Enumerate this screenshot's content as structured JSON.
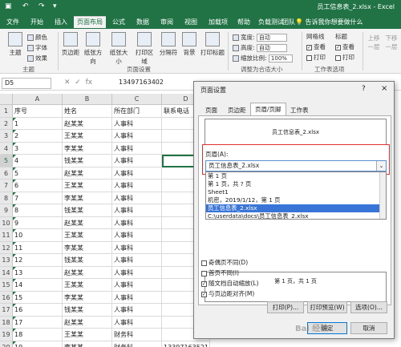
{
  "titlebar": {
    "doc_title": "员工信息表_2.xlsx - Excel"
  },
  "tabs": [
    "文件",
    "开始",
    "插入",
    "页面布局",
    "公式",
    "数据",
    "审阅",
    "视图",
    "加载项",
    "帮助",
    "负载测试",
    "团队"
  ],
  "active_tab": "页面布局",
  "tell_me": "告诉我你想要做什么",
  "ribbon": {
    "theme": "主题",
    "colors": "颜色",
    "fonts": "字体",
    "effects": "效果",
    "theme_group": "主题",
    "margins": "页边距",
    "orientation": "纸张方向",
    "size": "纸张大小",
    "print_area": "打印区域",
    "breaks": "分隔符",
    "background": "背景",
    "print_titles": "打印标题",
    "page_setup_group": "页面设置",
    "width_label": "宽度:",
    "height_label": "高度:",
    "scale_label": "缩放比例:",
    "auto": "自动",
    "scale_value": "100%",
    "fit_group": "调整为合适大小",
    "gridlines": "网格线",
    "headings": "标题",
    "view": "查看",
    "print": "打印",
    "sheet_options_group": "工作表选项",
    "bring_forward": "上移一层",
    "send_backward": "下移一层"
  },
  "formula_bar": {
    "name_box": "D5",
    "value": "13497163402"
  },
  "columns": [
    "A",
    "B",
    "C",
    "D"
  ],
  "row_numbers": [
    "1",
    "2",
    "3",
    "4",
    "5",
    "6",
    "7",
    "8",
    "9",
    "10",
    "11",
    "12",
    "13",
    "14",
    "15",
    "16",
    "17",
    "18",
    "19",
    "20"
  ],
  "rows": [
    [
      "序号",
      "姓名",
      "所在部门",
      "联系电话"
    ],
    [
      "1",
      "赵某某",
      "人事科",
      ""
    ],
    [
      "2",
      "王某某",
      "人事科",
      ""
    ],
    [
      "3",
      "李某某",
      "人事科",
      ""
    ],
    [
      "4",
      "钱某某",
      "人事科",
      ""
    ],
    [
      "5",
      "赵某某",
      "人事科",
      ""
    ],
    [
      "6",
      "王某某",
      "人事科",
      ""
    ],
    [
      "7",
      "李某某",
      "人事科",
      ""
    ],
    [
      "8",
      "钱某某",
      "人事科",
      ""
    ],
    [
      "9",
      "赵某某",
      "人事科",
      ""
    ],
    [
      "10",
      "王某某",
      "人事科",
      ""
    ],
    [
      "11",
      "李某某",
      "人事科",
      ""
    ],
    [
      "12",
      "钱某某",
      "人事科",
      ""
    ],
    [
      "13",
      "赵某某",
      "人事科",
      ""
    ],
    [
      "14",
      "王某某",
      "人事科",
      ""
    ],
    [
      "15",
      "李某某",
      "人事科",
      ""
    ],
    [
      "16",
      "钱某某",
      "人事科",
      ""
    ],
    [
      "17",
      "赵某某",
      "人事科",
      ""
    ],
    [
      "18",
      "王某某",
      "财务科",
      ""
    ],
    [
      "19",
      "李某某",
      "财务科",
      "13397163521"
    ]
  ],
  "dialog": {
    "title": "页面设置",
    "help": "?",
    "close": "×",
    "tabs": [
      "页面",
      "页边距",
      "页眉/页脚",
      "工作表"
    ],
    "active_tab": "页眉/页脚",
    "header_preview": "员工信息表_2.xlsx",
    "header_label": "页眉(A):",
    "header_value": "员工信息表_2.xlsx",
    "header_options": [
      "第 1 页",
      "第 1 页，共 ? 页",
      "Sheet1",
      "机密，2019/1/12，第 1 页",
      "员工信息表_2.xlsx",
      "C:\\userdata\\docs\\员工信息表_2.xlsx"
    ],
    "highlighted_option": "员工信息表_2.xlsx",
    "footer_preview": "第 1 页，共 1 页",
    "checkboxes": [
      {
        "label": "奇偶页不同(D)",
        "checked": false
      },
      {
        "label": "首页不同(I)",
        "checked": false
      },
      {
        "label": "随文档自动缩放(L)",
        "checked": true
      },
      {
        "label": "与页边距对齐(M)",
        "checked": true
      }
    ],
    "print_button": "打印(P)...",
    "preview_button": "打印预览(W)",
    "options_button": "选项(O)...",
    "ok_button": "确定",
    "cancel_button": "取消"
  },
  "watermark": "Bai 经验"
}
